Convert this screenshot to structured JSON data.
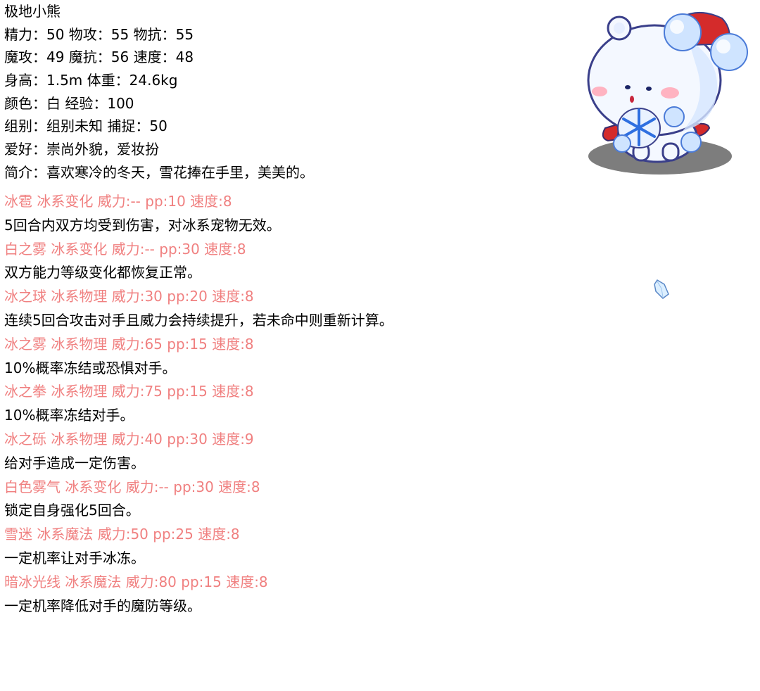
{
  "info": {
    "name": "极地小熊",
    "stats1": "精力：50 物攻：55 物抗：55",
    "stats2": "魔攻：49 魔抗：56 速度：48",
    "body": "身高：1.5m 体重：24.6kg",
    "color": "颜色：白 经验：100",
    "group": "组别：组别未知 捕捉：50",
    "hobby": "爱好：崇尚外貌，爱妆扮",
    "intro": "简介：喜欢寒冷的冬天，雪花捧在手里，美美的。"
  },
  "skills": [
    {
      "head": "冰雹 冰系变化 威力:-- pp:10 速度:8",
      "desc": "5回合内双方均受到伤害，对冰系宠物无效。"
    },
    {
      "head": "白之雾 冰系变化 威力:-- pp:30 速度:8",
      "desc": "双方能力等级变化都恢复正常。"
    },
    {
      "head": "冰之球 冰系物理 威力:30 pp:20 速度:8",
      "desc": "连续5回合攻击对手且威力会持续提升，若未命中则重新计算。"
    },
    {
      "head": "冰之雾 冰系物理 威力:65 pp:15 速度:8",
      "desc": "10%概率冻结或恐惧对手。"
    },
    {
      "head": "冰之拳 冰系物理 威力:75 pp:15 速度:8",
      "desc": "10%概率冻结对手。"
    },
    {
      "head": "冰之砾 冰系物理 威力:40 pp:30 速度:9",
      "desc": "给对手造成一定伤害。"
    },
    {
      "head": "白色雾气 冰系变化 威力:-- pp:30 速度:8",
      "desc": "锁定自身强化5回合。"
    },
    {
      "head": "雪迷 冰系魔法 威力:50 pp:25 速度:8",
      "desc": "一定机率让对手冰冻。"
    },
    {
      "head": "暗冰光线 冰系魔法 威力:80 pp:15 速度:8",
      "desc": "一定机率降低对手的魔防等级。"
    }
  ],
  "colors": {
    "skill_head": "#f08080",
    "text": "#000000"
  },
  "icons": {
    "mascot": "polar-bear-mascot",
    "crystal": "ice-crystal-icon"
  }
}
